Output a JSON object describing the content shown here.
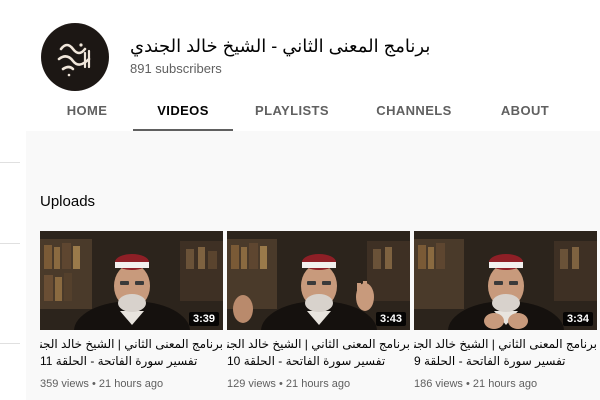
{
  "channel": {
    "name": "برنامج المعنى الثاني - الشيخ خالد الجندي",
    "subscribers": "891 subscribers",
    "avatar_icon": "channel-logo-calligraphy"
  },
  "tabs": [
    {
      "label": "HOME",
      "active": false
    },
    {
      "label": "VIDEOS",
      "active": true
    },
    {
      "label": "PLAYLISTS",
      "active": false
    },
    {
      "label": "CHANNELS",
      "active": false
    },
    {
      "label": "ABOUT",
      "active": false
    }
  ],
  "uploads": {
    "title": "Uploads",
    "videos": [
      {
        "duration": "3:39",
        "title_line1": "برنامج المعنى الثاني | الشيخ خالد الجندي -",
        "title_line2": "تفسير سورة الفاتحة - الحلقة 11",
        "views": "359 views",
        "age": "21 hours ago"
      },
      {
        "duration": "3:43",
        "title_line1": "برنامج المعنى الثاني | الشيخ خالد الجندي -",
        "title_line2": "تفسير سورة الفاتحة - الحلقة 10",
        "views": "129 views",
        "age": "21 hours ago"
      },
      {
        "duration": "3:34",
        "title_line1": "برنامج المعنى الثاني | الشيخ خالد الجندي -",
        "title_line2": "تفسير سورة الفاتحة - الحلقة 9",
        "views": "186 views",
        "age": "21 hours ago"
      }
    ]
  },
  "colors": {
    "background": "#f9f9f9",
    "header_bg": "#ffffff",
    "text_primary": "#030303",
    "text_secondary": "#606060"
  }
}
